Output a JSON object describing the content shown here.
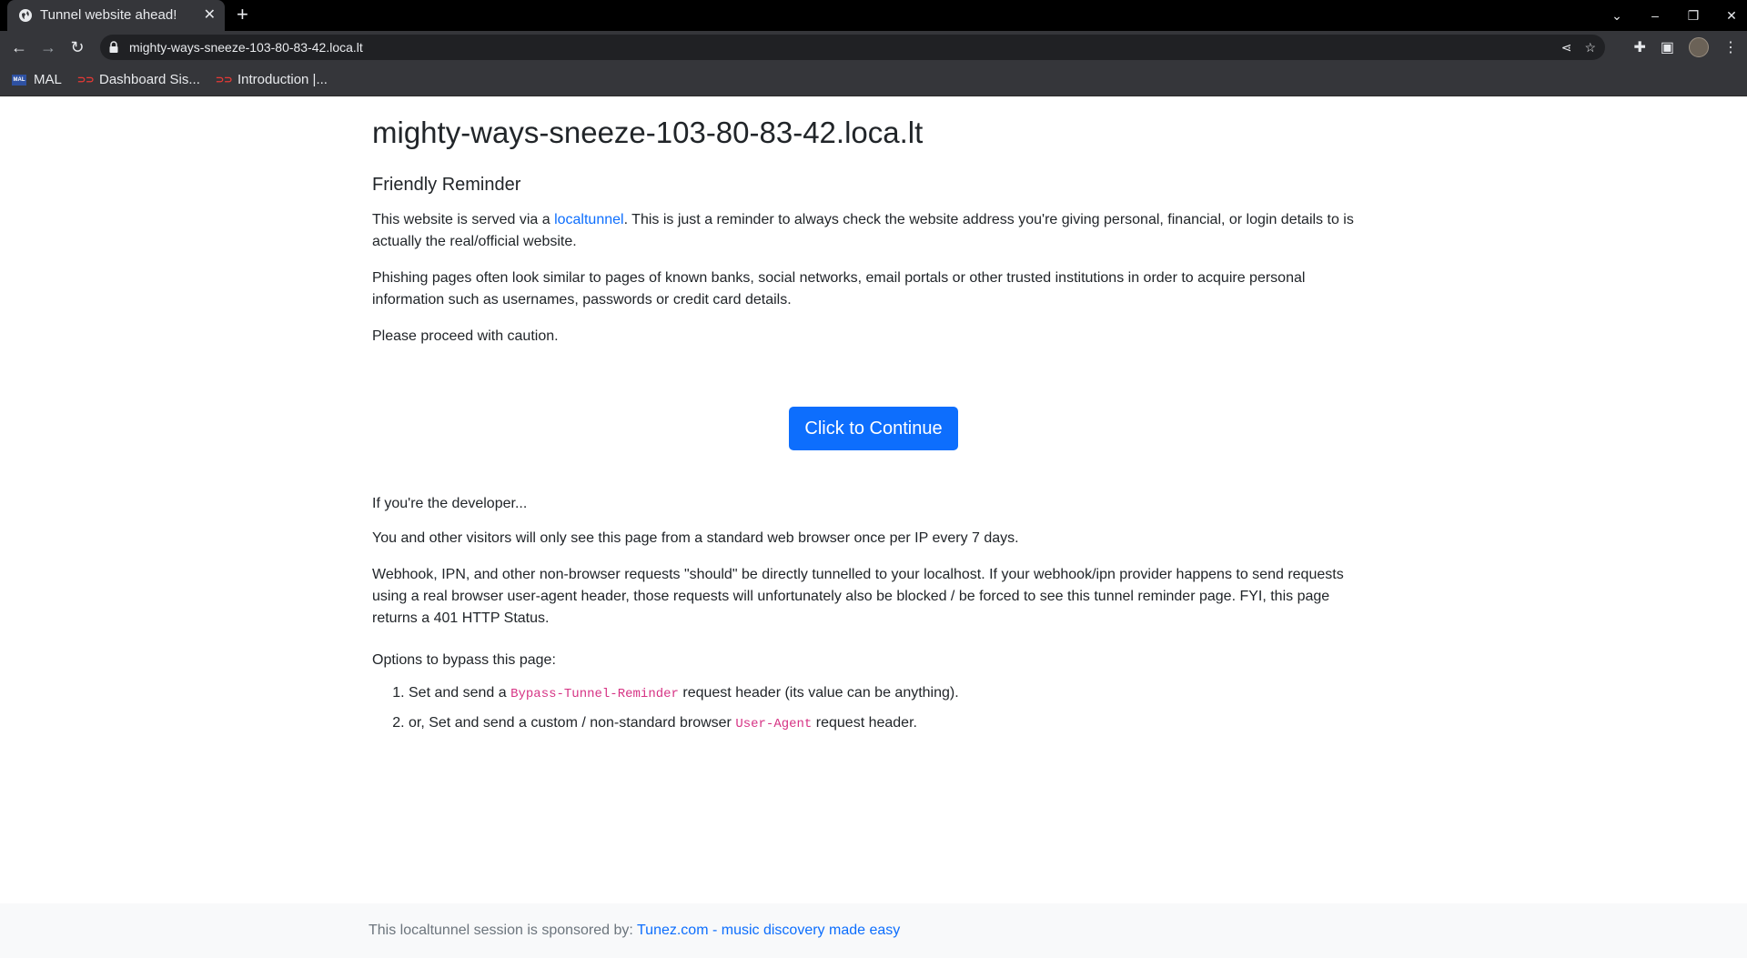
{
  "browser": {
    "tab_title": "Tunnel website ahead!",
    "tab_close": "✕",
    "new_tab": "+",
    "url": "mighty-ways-sneeze-103-80-83-42.loca.lt",
    "bookmarks": [
      {
        "label": "MAL",
        "icon": "MAL"
      },
      {
        "label": "Dashboard Sis...",
        "icon": "red-logo"
      },
      {
        "label": "Introduction |...",
        "icon": "red-logo"
      }
    ]
  },
  "page": {
    "heading": "mighty-ways-sneeze-103-80-83-42.loca.lt",
    "subheading": "Friendly Reminder",
    "p1_before": "This website is served via a ",
    "p1_link": "localtunnel",
    "p1_after": ". This is just a reminder to always check the website address you're giving personal, financial, or login details to is actually the real/official website.",
    "p2": "Phishing pages often look similar to pages of known banks, social networks, email portals or other trusted institutions in order to acquire personal information such as usernames, passwords or credit card details.",
    "p3": "Please proceed with caution.",
    "button": "Click to Continue",
    "dev_intro": "If you're the developer...",
    "dev_p1": "You and other visitors will only see this page from a standard web browser once per IP every 7 days.",
    "dev_p2": "Webhook, IPN, and other non-browser requests \"should\" be directly tunnelled to your localhost. If your webhook/ipn provider happens to send requests using a real browser user-agent header, those requests will unfortunately also be blocked / be forced to see this tunnel reminder page. FYI, this page returns a 401 HTTP Status.",
    "options_title": "Options to bypass this page:",
    "options": [
      {
        "before": "Set and send a ",
        "code": "Bypass-Tunnel-Reminder",
        "after": " request header (its value can be anything)."
      },
      {
        "before": "or, Set and send a custom / non-standard browser ",
        "code": "User-Agent",
        "after": " request header."
      }
    ]
  },
  "footer": {
    "text": "This localtunnel session is sponsored by: ",
    "link": "Tunez.com - music discovery made easy"
  },
  "colors": {
    "primary": "#0d6efd",
    "code": "#d63384",
    "chrome_bg": "#35363a",
    "footer_bg": "#f8f9fa"
  }
}
